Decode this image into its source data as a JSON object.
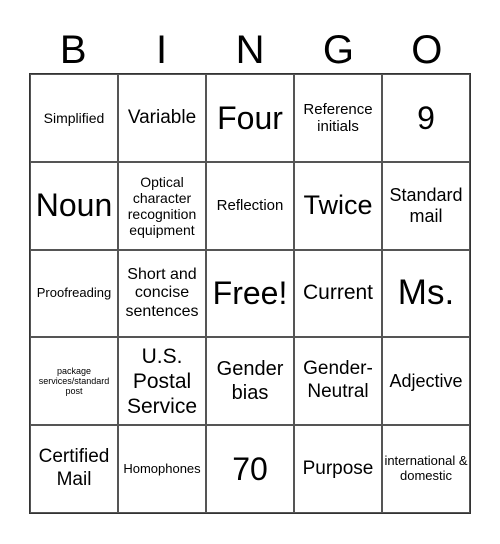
{
  "header": {
    "letters": [
      "B",
      "I",
      "N",
      "G",
      "O"
    ]
  },
  "board": {
    "rows": [
      [
        "Simplified",
        "Variable",
        "Four",
        "Reference initials",
        "9"
      ],
      [
        "Noun",
        "Optical character recognition equipment",
        "Reflection",
        "Twice",
        "Standard mail"
      ],
      [
        "Proofreading",
        "Short and concise sentences",
        "Free!",
        "Current",
        "Ms."
      ],
      [
        "package services/standard post",
        "U.S. Postal Service",
        "Gender bias",
        "Gender-Neutral",
        "Adjective"
      ],
      [
        "Certified Mail",
        "Homophones",
        "70",
        "Purpose",
        "international & domestic"
      ]
    ]
  }
}
